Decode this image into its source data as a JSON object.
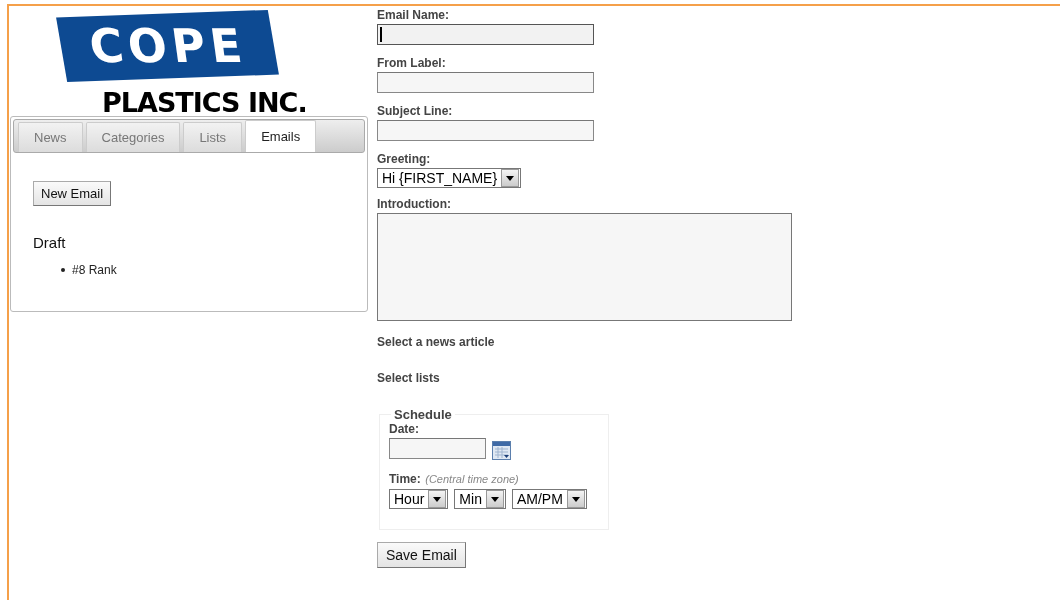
{
  "logo": {
    "name": "COPE",
    "subtitle": "PLASTICS INC."
  },
  "tabs": [
    {
      "label": "News",
      "selected": false
    },
    {
      "label": "Categories",
      "selected": false
    },
    {
      "label": "Lists",
      "selected": false
    },
    {
      "label": "Emails",
      "selected": true
    }
  ],
  "panel": {
    "button": "New Email",
    "heading": "Draft",
    "items": [
      "#8 Rank"
    ]
  },
  "form": [
    {
      "kind": "text",
      "label": "Email Name:",
      "focused": true
    },
    {
      "kind": "text",
      "label": "From Label:",
      "focused": false
    },
    {
      "kind": "text",
      "label": "Subject Line:",
      "focused": false
    },
    {
      "kind": "select",
      "label": "Greeting:",
      "value": "Hi {FIRST_NAME}"
    },
    {
      "kind": "textarea",
      "label": "Introduction:"
    },
    {
      "kind": "section",
      "label": "Select a news article"
    },
    {
      "kind": "section",
      "label": "Select lists"
    }
  ],
  "schedule": {
    "legend": "Schedule",
    "date_label": "Date:",
    "time_label": "Time:",
    "time_note": "(Central time zone)",
    "time_selects": [
      "Hour",
      "Min",
      "AM/PM"
    ]
  },
  "save_button": "Save Email"
}
